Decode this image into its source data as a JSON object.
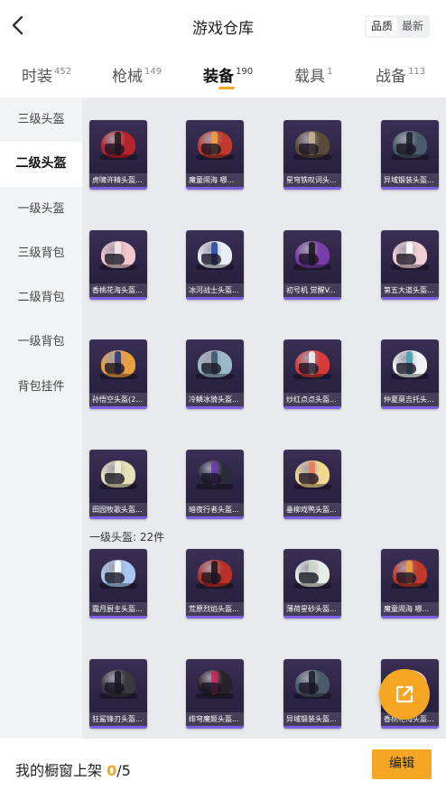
{
  "header": {
    "title": "游戏仓库",
    "sort_options": [
      "品质",
      "最新"
    ],
    "sort_selected": 0
  },
  "tabs": [
    {
      "label": "时装",
      "count": "452"
    },
    {
      "label": "枪械",
      "count": "149"
    },
    {
      "label": "装备",
      "count": "190"
    },
    {
      "label": "载具",
      "count": "1"
    },
    {
      "label": "战备",
      "count": "113"
    }
  ],
  "active_tab": 2,
  "sidebar": {
    "items": [
      "三级头盔",
      "二级头盔",
      "一级头盔",
      "三级背包",
      "二级背包",
      "一级背包",
      "背包挂件"
    ],
    "active": 1
  },
  "section_level2": {
    "items": [
      {
        "name": "虎啸许精头盔...",
        "color": "#b8222b",
        "visor": "#2a1a1a"
      },
      {
        "name": "魔童闹海 哪...",
        "color": "#c0392b",
        "visor": "#f0a040"
      },
      {
        "name": "星穹铁叹词头...",
        "color": "#5a4a3a",
        "visor": "#c8b090"
      },
      {
        "name": "异域锻装头盔...",
        "color": "#4a5a6a",
        "visor": "#1a2430"
      },
      {
        "name": "香桃花海头盔...",
        "color": "#f2c6cc",
        "visor": "#f8e6e8"
      },
      {
        "name": "冰河战士头盔...",
        "color": "#e8eef6",
        "visor": "#2c4aa0"
      },
      {
        "name": "初号机 觉醒V...",
        "color": "#7a3ca8",
        "visor": "#1a1a1a"
      },
      {
        "name": "第五大道头盔...",
        "color": "#f0d0d6",
        "visor": "#ffffff"
      },
      {
        "name": "孙悟空头盔(2...",
        "color": "#e8a040",
        "visor": "#2a3a7a"
      },
      {
        "name": "冷鳞冰猗头盔...",
        "color": "#9ab8c8",
        "visor": "#3a5a6a"
      },
      {
        "name": "炒红点点头盔...",
        "color": "#d83a3a",
        "visor": "#f0f0f0"
      },
      {
        "name": "仲夏莫吉托头...",
        "color": "#f0f4f6",
        "visor": "#4aa0a8"
      },
      {
        "name": "田园牧歌头盔...",
        "color": "#e8e0b8",
        "visor": "#f4f0d8"
      },
      {
        "name": "暗夜行者头盔...",
        "color": "#2a2a3a",
        "visor": "#6a3aa8"
      },
      {
        "name": "垂柳戏鸭头盔...",
        "color": "#f0d890",
        "visor": "#e87a5a"
      }
    ]
  },
  "section_level1": {
    "label": "一级头盔: 22件",
    "items": [
      {
        "name": "霜月厨主头盔...",
        "color": "#a8c8f0",
        "visor": "#ffffff"
      },
      {
        "name": "荒原烈焰头盔...",
        "color": "#b83028",
        "visor": "#2a1414"
      },
      {
        "name": "薄荷星砂头盔...",
        "color": "#e6ece6",
        "visor": "#c8d8c8"
      },
      {
        "name": "魔童闹海 哪...",
        "color": "#c0392b",
        "visor": "#f0a040"
      },
      {
        "name": "狂鲨锋刃头盔...",
        "color": "#3a3a42",
        "visor": "#1a1a20"
      },
      {
        "name": "绯穹魔姬头盔...",
        "color": "#2a2028",
        "visor": "#c82a5a"
      },
      {
        "name": "异域锻装头盔...",
        "color": "#4a5a6a",
        "visor": "#1a2430"
      },
      {
        "name": "香桃花海头盔...",
        "color": "#f2c6cc",
        "visor": "#f8e6e8"
      }
    ]
  },
  "footer": {
    "shelf_label": "我的橱窗上架 ",
    "shelf_count": "0",
    "shelf_total": "/5",
    "edit_label": "编辑"
  },
  "colors": {
    "accent": "#f5a623",
    "card_stripe": "#7d5fe6"
  }
}
